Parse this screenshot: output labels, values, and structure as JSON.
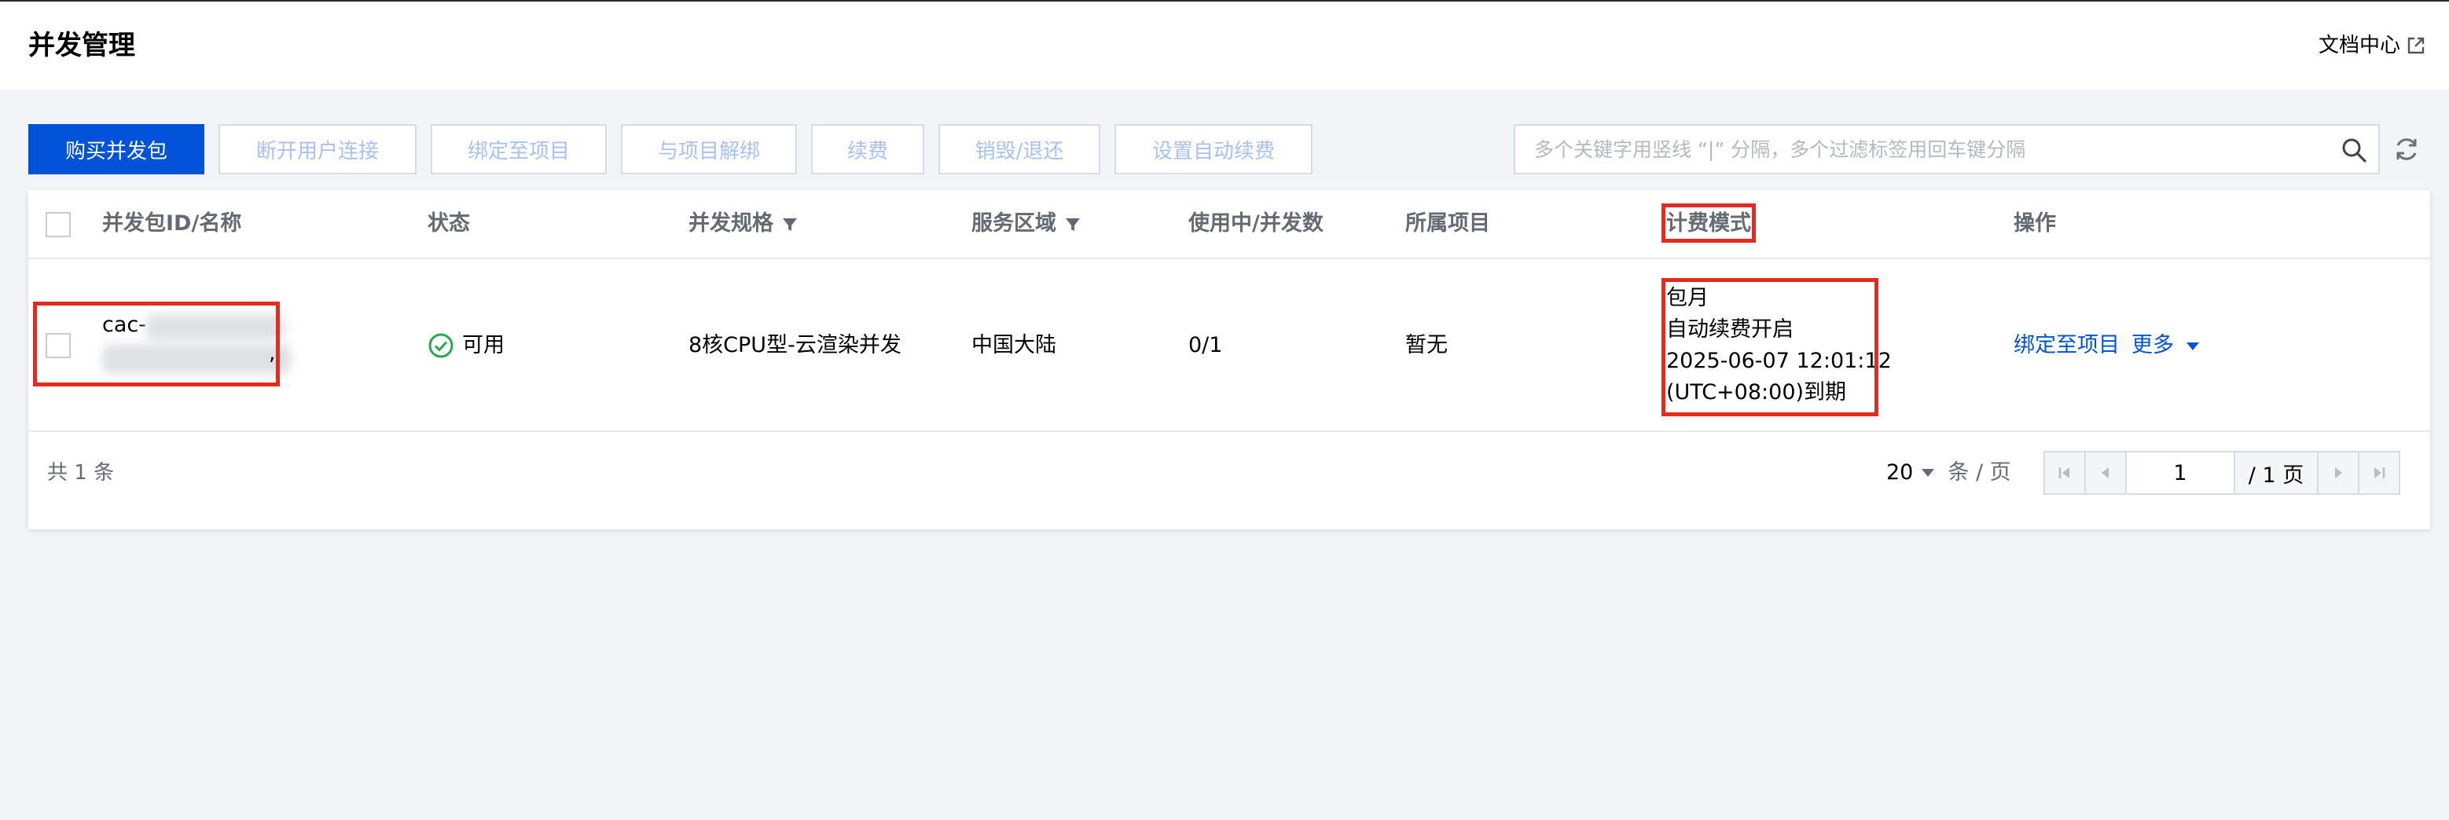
{
  "header": {
    "title": "并发管理",
    "doc_link": "文档中心"
  },
  "toolbar": {
    "buy": "购买并发包",
    "disconnect": "断开用户连接",
    "bind": "绑定至项目",
    "unbind": "与项目解绑",
    "renew": "续费",
    "destroy": "销毁/退还",
    "auto_renew": "设置自动续费"
  },
  "search": {
    "placeholder": "多个关键字用竖线 “|” 分隔，多个过滤标签用回车键分隔"
  },
  "table": {
    "columns": {
      "id": "并发包ID/名称",
      "status": "状态",
      "spec": "并发规格",
      "region": "服务区域",
      "usage": "使用中/并发数",
      "project": "所属项目",
      "billing": "计费模式",
      "action": "操作"
    },
    "rows": [
      {
        "id_prefix": "cac-",
        "id_suffix": ",",
        "status": "可用",
        "spec": "8核CPU型-云渲染并发",
        "region": "中国大陆",
        "usage": "0/1",
        "project": "暂无",
        "billing": [
          "包月",
          "自动续费开启",
          "2025-06-07 12:01:12",
          "(UTC+08:00)到期"
        ],
        "action_bind": "绑定至项目",
        "action_more": "更多"
      }
    ]
  },
  "footer": {
    "total": "共 1 条",
    "page_size": "20",
    "page_size_unit": "条 / 页",
    "current_page": "1",
    "total_pages": "/ 1 页"
  },
  "colors": {
    "primary": "#0052d9",
    "highlight_box": "#e32b1f",
    "status_ok": "#29a94b"
  }
}
